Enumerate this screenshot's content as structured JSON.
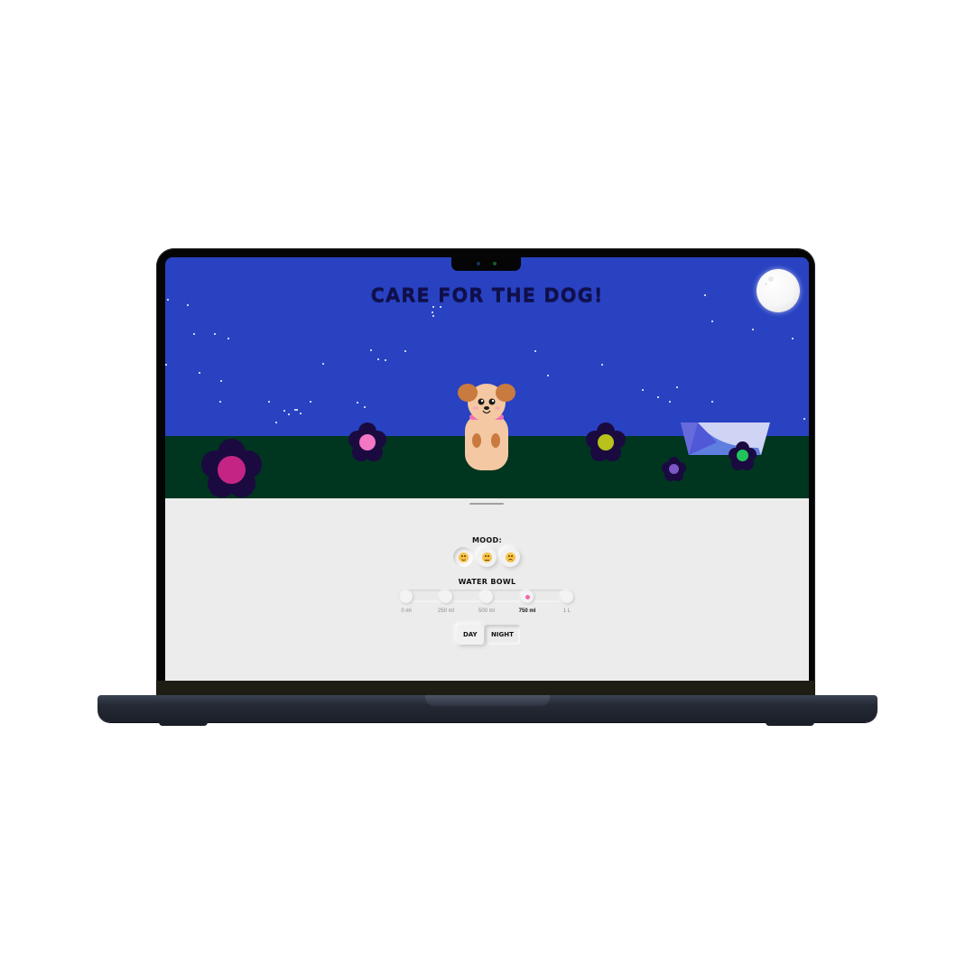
{
  "game": {
    "title": "CARE FOR THE DOG!",
    "mode": "night"
  },
  "controls": {
    "mood_label": "MOOD:",
    "mood_options": [
      {
        "icon": "smiling-face-icon",
        "selected": true
      },
      {
        "icon": "neutral-face-icon",
        "selected": false
      },
      {
        "icon": "sad-face-icon",
        "selected": false
      }
    ],
    "water_label": "WATER BOWL",
    "water_options": [
      "0 ml",
      "250 ml",
      "500 ml",
      "750 ml",
      "1 L"
    ],
    "water_selected": "750 ml",
    "day_label": "DAY",
    "night_label": "NIGHT"
  },
  "colors": {
    "sky": "#2842c2",
    "ground": "#003520",
    "panel": "#ececec",
    "title": "#0f0f4a",
    "flower_petals": "#1a0a40",
    "flower_centers": [
      "#c42585",
      "#f377c4",
      "#b7c21a",
      "#7b58c6",
      "#22c35a"
    ],
    "slider_dot": "#ef6aa8"
  }
}
